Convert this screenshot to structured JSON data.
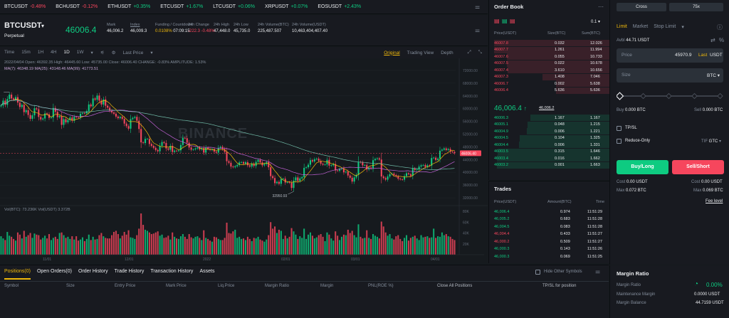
{
  "ticker": [
    {
      "symbol": "BTCUSDT",
      "change": "-0.48%",
      "dir": "r"
    },
    {
      "symbol": "BCHUSDT",
      "change": "-0.12%",
      "dir": "r"
    },
    {
      "symbol": "ETHUSDT",
      "change": "+0.35%",
      "dir": "g"
    },
    {
      "symbol": "ETCUSDT",
      "change": "+1.67%",
      "dir": "g"
    },
    {
      "symbol": "LTCUSDT",
      "change": "+0.06%",
      "dir": "g"
    },
    {
      "symbol": "XRPUSDT",
      "change": "+0.07%",
      "dir": "g"
    },
    {
      "symbol": "EOSUSDT",
      "change": "+2.43%",
      "dir": "g"
    }
  ],
  "header": {
    "symbol": "BTCUSDT",
    "subtitle": "Perpetual",
    "last_price": "46006.4",
    "stats": [
      {
        "label": "Mark",
        "value": "46,006.2"
      },
      {
        "label": "Index",
        "value": "46,009.3"
      },
      {
        "label": "Funding / Countdown",
        "value": "0.0108%",
        "value2": "07:09:15"
      },
      {
        "label": "24h Change",
        "value": "-222.3 -0.48%"
      },
      {
        "label": "24h High",
        "value": "47,448.0"
      },
      {
        "label": "24h Low",
        "value": "45,735.0"
      },
      {
        "label": "24h Volume(BTC)",
        "value": "225,487.507"
      },
      {
        "label": "24h Volume(USDT)",
        "value": "10,463,404,407.40"
      }
    ]
  },
  "chart_toolbar": {
    "intervals": [
      "Time",
      "15m",
      "1H",
      "4H",
      "1D",
      "1W"
    ],
    "active_interval": "1D",
    "price_type": "Last Price",
    "views": [
      "Original",
      "Trading View",
      "Depth"
    ],
    "active_view": "Original"
  },
  "chart_legend": {
    "ohlc": "2022/04/04  Open: 46392.35  High: 46445.60  Low: 45735.00  Close: 46006.40  CHANGE: -0.83%  AMPLITUDE: 1.53%",
    "ma": "MA(7): 46348.19  MA(25): 43148.46  MA(99): 41773.51",
    "vol": "Vol(BTC): 73.236K  Vol(USDT) 3.372B"
  },
  "chart_data": {
    "type": "candlestick",
    "watermark": "BINANCE",
    "y_ticks": [
      "72000.00",
      "68000.00",
      "64000.00",
      "60000.00",
      "56000.00",
      "52000.00",
      "48000.00",
      "44000.00",
      "40000.00",
      "36000.00",
      "32000.00"
    ],
    "ylim": [
      30000,
      74000
    ],
    "last_price_label": "46006.40",
    "high_label": "69198.70",
    "low_label": "32950.93",
    "x_ticks": [
      "11/01",
      "12/01",
      "2022",
      "02/01",
      "03/01",
      "04/01"
    ],
    "vol_ticks": [
      "80K",
      "60K",
      "40K",
      "20K"
    ],
    "closes": [
      61000,
      62500,
      61200,
      63000,
      64400,
      63200,
      62800,
      63600,
      61900,
      60500,
      61200,
      58900,
      59500,
      58000,
      56800,
      57900,
      60100,
      59800,
      57400,
      56600,
      56900,
      58500,
      58200,
      57100,
      57200,
      60200,
      59000,
      57300,
      57700,
      54900,
      56700,
      55700,
      56400,
      57200,
      56200,
      57400,
      57300,
      57200,
      58400,
      58600,
      58500,
      59200,
      61300,
      60700,
      63200,
      62800,
      64100,
      62500,
      61300,
      62900,
      60900,
      60300,
      59400,
      58800,
      58400,
      57500,
      57000,
      57400,
      56800,
      55300,
      54500,
      53700,
      56700,
      57100,
      57400,
      56200,
      53600,
      49400,
      49200,
      50500,
      50500,
      48900,
      48300,
      47700,
      47000,
      46600,
      48300,
      49500,
      49200,
      47500,
      47100,
      48300,
      46400,
      46800,
      46700,
      46900,
      48600,
      50800,
      50700,
      49300,
      47800,
      47100,
      47200,
      47500,
      47800,
      47200,
      47600,
      46200,
      47700,
      47300,
      47000,
      47300,
      46500,
      46200,
      47700,
      48000,
      47300,
      46400,
      43500,
      43000,
      41800,
      41600,
      41900,
      42300,
      43100,
      43200,
      42700,
      43200,
      42200,
      41800,
      42700,
      42000,
      43300,
      43900,
      43100,
      42200,
      42600,
      43200,
      41600,
      38800,
      38200,
      36600,
      37000,
      36400,
      37900,
      38000,
      36800,
      36900,
      36700,
      35100,
      37400,
      38400,
      37300,
      38100,
      38500,
      41400,
      41600,
      42400,
      43800,
      43400,
      44100,
      44300,
      43600,
      42700,
      42400,
      42500,
      43900,
      42100,
      42200,
      42600,
      40600,
      40500,
      41000,
      41200,
      40000,
      40200,
      39000,
      38300,
      37100,
      38400,
      39200,
      43300,
      43100,
      42200,
      42300,
      40900,
      41500,
      41300,
      43800,
      44200,
      44400,
      44000,
      38700,
      38200,
      37700,
      38700,
      39400,
      39600,
      39100,
      38700,
      38000,
      37800,
      37700,
      38800,
      39700,
      39400,
      38900,
      41200,
      40700,
      40900,
      41800,
      42200,
      42300,
      41700,
      42200,
      42100,
      44500,
      44600,
      43900,
      44300,
      46800,
      47100,
      47500,
      47000,
      47300,
      46500,
      46400,
      46000
    ],
    "volumes": [
      34,
      30,
      27,
      42,
      35,
      33,
      29,
      26,
      41,
      37,
      30,
      44,
      33,
      36,
      40,
      31,
      39,
      37,
      36,
      28,
      31,
      35,
      30,
      38,
      27,
      31,
      33,
      29,
      40,
      41,
      36,
      31,
      33,
      29,
      34,
      28,
      34,
      26,
      28,
      32,
      25,
      29,
      37,
      27,
      33,
      28,
      29,
      36,
      40,
      34,
      31,
      30,
      30,
      36,
      42,
      44,
      38,
      30,
      35,
      42,
      37,
      45,
      32,
      31,
      29,
      36,
      48,
      76,
      55,
      46,
      44,
      41,
      38,
      39,
      41,
      43,
      35,
      37,
      31,
      32,
      35,
      28,
      41,
      33,
      30,
      29,
      34,
      38,
      33,
      29,
      38,
      32,
      30,
      33,
      34,
      31,
      27,
      45,
      31,
      29,
      26,
      24,
      33,
      32,
      29,
      27,
      27,
      31,
      59,
      40,
      39,
      43,
      46,
      31,
      33,
      29,
      30,
      27,
      33,
      29,
      25,
      31,
      30,
      33,
      28,
      26,
      24,
      28,
      36,
      60,
      48,
      52,
      40,
      46,
      44,
      29,
      35,
      30,
      33,
      49,
      43,
      37,
      29,
      34,
      31,
      48,
      29,
      37,
      41,
      35,
      30,
      32,
      36,
      38,
      33,
      25,
      41,
      37,
      30,
      26,
      43,
      35,
      27,
      33,
      37,
      36,
      46,
      40,
      44,
      36,
      32,
      56,
      33,
      30,
      31,
      45,
      31,
      29,
      38,
      35,
      33,
      30,
      61,
      52,
      41,
      35,
      38,
      30,
      28,
      34,
      36,
      29,
      25,
      31,
      36,
      26,
      31,
      33,
      35,
      30,
      27,
      36,
      32,
      33,
      34,
      31,
      32,
      48,
      31,
      34,
      33,
      41,
      36,
      38,
      34,
      33,
      29,
      27
    ]
  },
  "orderbook": {
    "title": "Order Book",
    "precision": "0.1",
    "headers": [
      "Price(USDT)",
      "Size(BTC)",
      "Sum(BTC)"
    ],
    "asks": [
      [
        "46007.8",
        "0.032",
        "12.026"
      ],
      [
        "46007.7",
        "1.261",
        "11.994"
      ],
      [
        "46007.6",
        "0.055",
        "10.733"
      ],
      [
        "46007.5",
        "0.022",
        "10.678"
      ],
      [
        "46007.4",
        "3.610",
        "10.656"
      ],
      [
        "46007.3",
        "1.408",
        "7.046"
      ],
      [
        "46006.7",
        "0.002",
        "5.638"
      ],
      [
        "46006.4",
        "5.636",
        "5.636"
      ]
    ],
    "mid_price": "46,006.4",
    "mid_arrow": "↑",
    "mark": "46,006.2",
    "bids": [
      [
        "46006.3",
        "1.167",
        "1.167"
      ],
      [
        "46005.1",
        "0.048",
        "1.215"
      ],
      [
        "46004.9",
        "0.006",
        "1.221"
      ],
      [
        "46004.5",
        "0.104",
        "1.325"
      ],
      [
        "46004.4",
        "0.006",
        "1.331"
      ],
      [
        "46003.5",
        "0.315",
        "1.646"
      ],
      [
        "46003.4",
        "0.016",
        "1.662"
      ],
      [
        "46003.2",
        "0.001",
        "1.663"
      ]
    ]
  },
  "trades": {
    "title": "Trades",
    "headers": [
      "Price(USDT)",
      "Amount(BTC)",
      "Time"
    ],
    "rows": [
      [
        "46,006.4",
        "0.974",
        "11:51:29",
        "g"
      ],
      [
        "46,005.2",
        "0.683",
        "11:51:28",
        "g"
      ],
      [
        "46,004.5",
        "0.083",
        "11:51:28",
        "g"
      ],
      [
        "46,004.4",
        "0.433",
        "11:51:27",
        "r"
      ],
      [
        "46,000.2",
        "0.509",
        "11:51:27",
        "r"
      ],
      [
        "46,000.3",
        "0.143",
        "11:51:26",
        "g"
      ],
      [
        "46,000.3",
        "0.069",
        "11:51:25",
        "g"
      ]
    ]
  },
  "order_form": {
    "margin_mode": "Cross",
    "leverage": "75x",
    "tabs": [
      "Limit",
      "Market",
      "Stop Limit"
    ],
    "active_tab": "Limit",
    "avbl_label": "Avbl",
    "avbl_value": "44.71 USDT",
    "price_label": "Price",
    "price_value": "45970.9",
    "last_tag": "Last",
    "price_unit": "USDT",
    "size_label": "Size",
    "size_unit": "BTC",
    "buy_label": "Buy",
    "buy_value": "0.000 BTC",
    "sell_label": "Sell",
    "sell_value": "0.000 BTC",
    "tpsl": "TP/SL",
    "reduce_only": "Reduce-Only",
    "tif_label": "TIF",
    "tif_value": "GTC",
    "buy_button": "Buy/Long",
    "sell_button": "Sell/Short",
    "cost_buy": "0.00 USDT",
    "cost_sell": "0.00 USDT",
    "cost_label": "Cost",
    "max_label": "Max",
    "max_buy": "0.072 BTC",
    "max_sell": "0.069 BTC",
    "fee_level": "Fee level"
  },
  "margin_ratio": {
    "title": "Margin Ratio",
    "rows": [
      [
        "Margin Ratio",
        "0.00%"
      ],
      [
        "Maintenance Margin",
        "0.0000 USDT"
      ],
      [
        "Margin Balance",
        "44.7159 USDT"
      ]
    ]
  },
  "bottom": {
    "tabs": [
      "Positions(0)",
      "Open Orders(0)",
      "Order History",
      "Trade History",
      "Transaction History",
      "Assets"
    ],
    "active_tab": "Positions(0)",
    "hide_label": "Hide Other Symbols",
    "columns": [
      "Symbol",
      "Size",
      "Entry Price",
      "Mark Price",
      "Liq.Price",
      "Margin Ratio",
      "Margin",
      "PNL(ROE %)",
      "Close All Positions",
      "TP/SL for position"
    ]
  },
  "colors": {
    "up": "#0ecb81",
    "down": "#f6465d",
    "accent": "#f0b90b",
    "ma7": "#f0b90b",
    "ma25": "#c462d8",
    "ma99": "#6fb9a6"
  }
}
